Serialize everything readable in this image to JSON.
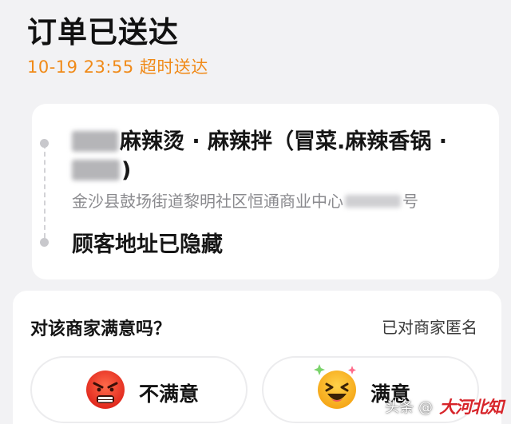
{
  "order": {
    "status_title": "订单已送达",
    "delivery_info": "10-19 23:55 超时送达",
    "status_color": "#f08a18"
  },
  "route": {
    "shop_name": "麻辣烫 · 麻辣拌（冒菜.麻辣香锅 ·",
    "shop_name_tail": ")",
    "shop_address_prefix": "金沙县鼓场街道黎明社区恒通商业中心",
    "shop_address_suffix": "号",
    "customer_address": "顾客地址已隐藏"
  },
  "rating": {
    "question": "对该商家满意吗？",
    "anonymous_label": "已对商家匿名",
    "options": [
      {
        "label": "不满意",
        "icon": "angry-face-icon"
      },
      {
        "label": "满意",
        "icon": "happy-face-icon"
      }
    ]
  },
  "watermark": {
    "text": "头条 @",
    "logo_text": "大河北知"
  }
}
